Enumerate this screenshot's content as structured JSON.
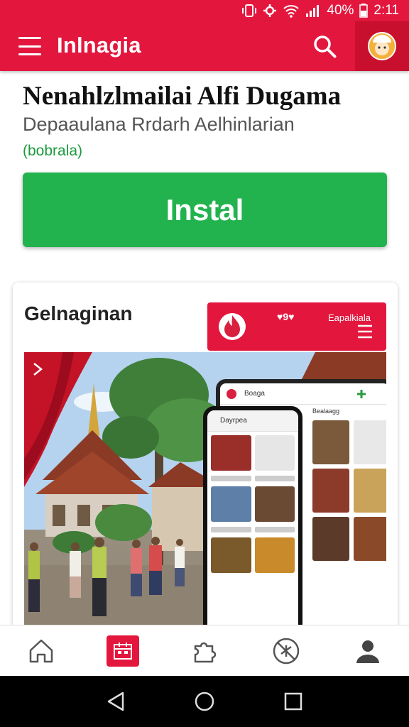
{
  "status_bar": {
    "battery": "40%",
    "time": "2:11"
  },
  "app_bar": {
    "title": "Inlnagia"
  },
  "header": {
    "app_name": "Nenahlzlmailai Alfi Dugama",
    "developer": "Depaaulana Rrdarh Aelhinlarian",
    "category": "(bobrala)",
    "install_label": "Instal"
  },
  "gallery": {
    "title": "Gelnaginan",
    "preview_brand": "Eapalkiala",
    "preview_hearts": "♥9♥",
    "app_header_label": "Boaga",
    "app_section_label": "Dayrpea",
    "app_section2_label": "Bealaagg"
  },
  "bottom_nav": {
    "items": [
      "home-icon",
      "calendar-icon",
      "puzzle-icon",
      "no-entry-icon",
      "profile-icon"
    ]
  },
  "colors": {
    "brand_red": "#e3173e",
    "install_green": "#22b34f"
  }
}
